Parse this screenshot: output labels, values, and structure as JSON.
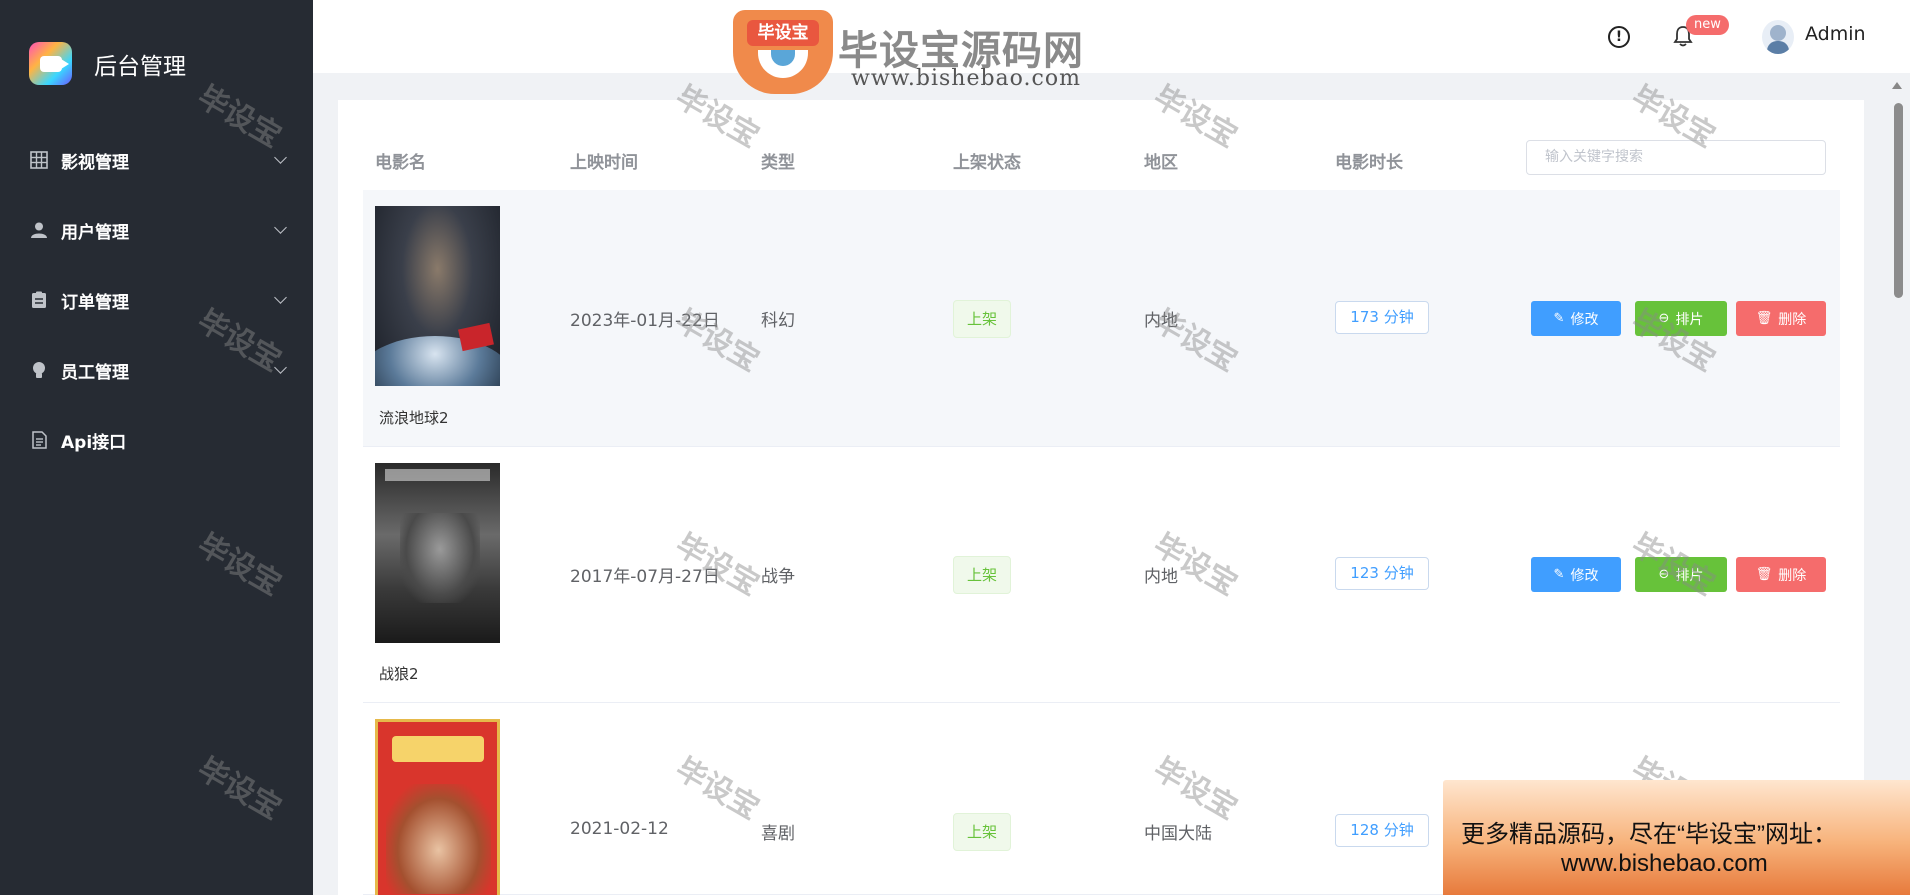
{
  "app": {
    "title": "后台管理"
  },
  "sidebar": {
    "items": [
      {
        "label": "影视管理",
        "icon": "grid-icon"
      },
      {
        "label": "用户管理",
        "icon": "user-icon"
      },
      {
        "label": "订单管理",
        "icon": "clipboard-icon"
      },
      {
        "label": "员工管理",
        "icon": "lightbulb-icon"
      },
      {
        "label": "Api接口",
        "icon": "document-icon"
      }
    ]
  },
  "header": {
    "badge": "new",
    "user": "Admin"
  },
  "watermark": {
    "logo_badge": "毕设宝",
    "name": "毕设宝源码网",
    "url": "www.bishebao.com",
    "text": "毕设宝"
  },
  "table": {
    "headers": [
      "电影名",
      "上映时间",
      "类型",
      "上架状态",
      "地区",
      "电影时长"
    ],
    "search_placeholder": "输入关键字搜索",
    "actions": {
      "edit": "修改",
      "schedule": "排片",
      "delete": "删除"
    },
    "rows": [
      {
        "name": "流浪地球2",
        "date": "2023年-01月-22日",
        "genre": "科幻",
        "status": "上架",
        "region": "内地",
        "duration": "173 分钟"
      },
      {
        "name": "战狼2",
        "date": "2017年-07月-27日",
        "genre": "战争",
        "status": "上架",
        "region": "内地",
        "duration": "123 分钟"
      },
      {
        "name": "",
        "date": "2021-02-12",
        "genre": "喜剧",
        "status": "上架",
        "region": "中国大陆",
        "duration": "128 分钟"
      }
    ]
  },
  "promo": {
    "line1": "更多精品源码，尽在“毕设宝”网址：",
    "line2": "www.bishebao.com"
  }
}
